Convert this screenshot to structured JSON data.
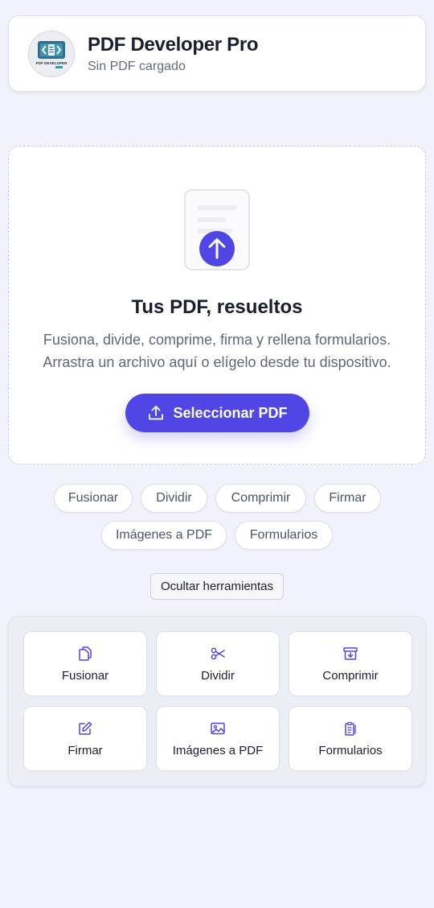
{
  "header": {
    "title": "PDF Developer Pro",
    "subtitle": "Sin PDF cargado",
    "logo_text": "PDF DEVELOPER"
  },
  "dropzone": {
    "title": "Tus PDF, resueltos",
    "description_line1": "Fusiona, divide, comprime, firma y rellena formularios.",
    "description_line2": "Arrastra un archivo aquí o elígelo desde tu dispositivo.",
    "button_label": "Seleccionar PDF"
  },
  "chips": [
    "Fusionar",
    "Dividir",
    "Comprimir",
    "Firmar",
    "Imágenes a PDF",
    "Formularios"
  ],
  "toggle_tools_label": "Ocultar herramientas",
  "tools": [
    {
      "label": "Fusionar",
      "icon": "copy-icon"
    },
    {
      "label": "Dividir",
      "icon": "scissors-icon"
    },
    {
      "label": "Comprimir",
      "icon": "archive-icon"
    },
    {
      "label": "Firmar",
      "icon": "pen-icon"
    },
    {
      "label": "Imágenes a PDF",
      "icon": "image-icon"
    },
    {
      "label": "Formularios",
      "icon": "clipboard-icon"
    }
  ],
  "colors": {
    "accent": "#4f46e5",
    "background": "#f1f2fb",
    "text": "#1b1e2e",
    "muted": "#626a7b"
  }
}
